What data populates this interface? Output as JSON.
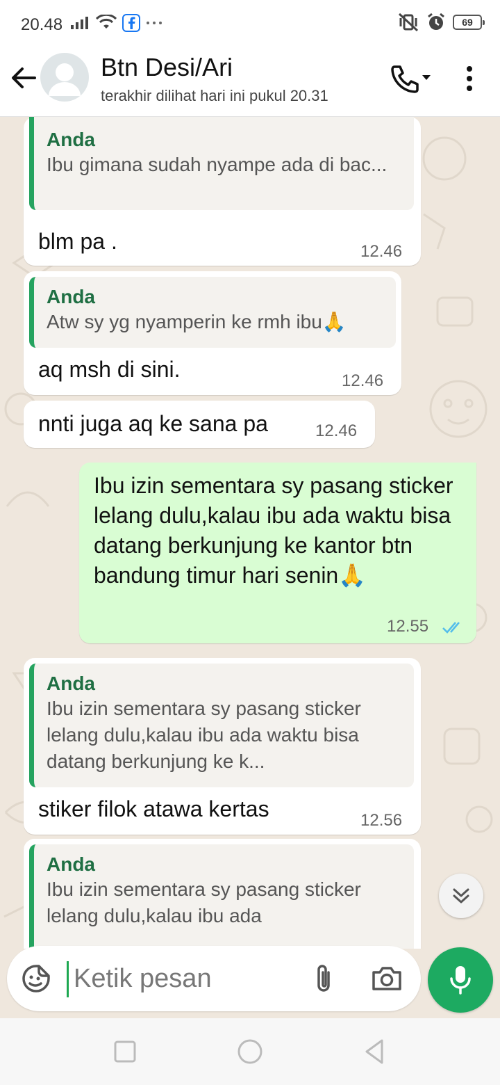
{
  "status_bar": {
    "time": "20.48",
    "battery": "69",
    "icons": [
      "signal-icon",
      "wifi-icon",
      "facebook-icon",
      "more-dots-icon",
      "vibrate-icon",
      "alarm-icon",
      "battery-icon"
    ]
  },
  "header": {
    "contact_name": "Btn Desi/Ari",
    "last_seen": "terakhir dilihat hari ini pukul 20.31",
    "icons": [
      "back-arrow-icon",
      "avatar-icon",
      "phone-call-icon",
      "more-vert-icon"
    ]
  },
  "messages": [
    {
      "direction": "in",
      "quote_name": "Anda",
      "quote_text": "Ibu gimana sudah nyampe ada di bac...",
      "text": "blm pa .",
      "time": "12.46"
    },
    {
      "direction": "in",
      "quote_name": "Anda",
      "quote_text": "Atw sy yg nyamperin ke rmh ibu🙏",
      "text": "aq msh di sini.",
      "time": "12.46"
    },
    {
      "direction": "in",
      "text": "nnti juga aq ke sana pa",
      "time": "12.46"
    },
    {
      "direction": "out",
      "text": "Ibu izin sementara sy pasang sticker lelang dulu,kalau ibu ada waktu bisa datang berkunjung ke kantor  btn bandung timur hari senin🙏",
      "time": "12.55",
      "status": "read"
    },
    {
      "direction": "in",
      "quote_name": "Anda",
      "quote_text": "Ibu izin sementara sy pasang sticker lelang dulu,kalau ibu ada waktu bisa datang berkunjung ke k...",
      "text": "stiker filok atawa kertas",
      "time": "12.56"
    },
    {
      "direction": "in",
      "quote_name": "Anda",
      "quote_text": "Ibu izin sementara sy pasang sticker lelang dulu,kalau ibu ada"
    }
  ],
  "input": {
    "placeholder": "Ketik pesan",
    "icons": [
      "emoji-sticker-icon",
      "attachment-icon",
      "camera-icon",
      "microphone-icon"
    ]
  },
  "navigation": {
    "icons": [
      "recent-apps-icon",
      "home-icon",
      "back-icon"
    ]
  },
  "colors": {
    "accent_green": "#1daa61",
    "outgoing_bubble": "#d9fdd3",
    "incoming_bubble": "#ffffff",
    "chat_background": "#efe7dd",
    "quote_bar": "#25a35f",
    "read_ticks": "#53bdeb"
  }
}
